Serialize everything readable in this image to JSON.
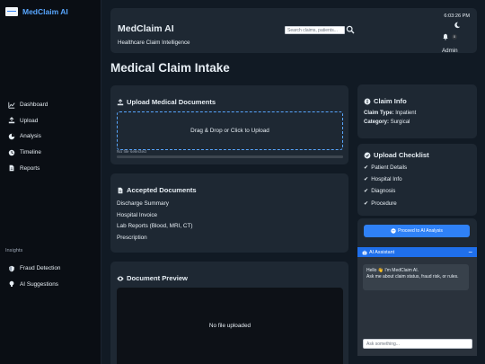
{
  "sidebar": {
    "brand": "MedClaim AI",
    "nav": [
      {
        "label": "Dashboard",
        "icon": "chart-line-icon"
      },
      {
        "label": "Upload",
        "icon": "upload-icon"
      },
      {
        "label": "Analysis",
        "icon": "analysis-icon"
      },
      {
        "label": "Timeline",
        "icon": "clock-icon"
      },
      {
        "label": "Reports",
        "icon": "file-icon"
      }
    ],
    "insights_label": "Insights",
    "insights": [
      {
        "label": "Fraud Detection",
        "icon": "shield-icon"
      },
      {
        "label": "AI Suggestions",
        "icon": "lightbulb-icon"
      }
    ]
  },
  "header": {
    "title": "MedClaim AI",
    "subtitle": "Healthcare Claim Intelligence",
    "search_placeholder": "Search claims, patients...",
    "time": "6:03:26 PM",
    "notification_count": "0",
    "user": "Admin"
  },
  "page_title": "Medical Claim Intake",
  "upload": {
    "title": "Upload Medical Documents",
    "dropzone_text": "Drag & Drop or Click to Upload",
    "file_status": "No file selected",
    "progress": 0
  },
  "accepted": {
    "title": "Accepted Documents",
    "items": [
      "Discharge Summary",
      "Hospital Invoice",
      "Lab Reports (Blood, MRI, CT)",
      "Prescription"
    ]
  },
  "preview": {
    "title": "Document Preview",
    "empty_text": "No file uploaded"
  },
  "claim_info": {
    "title": "Claim Info",
    "type_label": "Claim Type:",
    "type_value": "Inpatient",
    "category_label": "Category:",
    "category_value": "Surgical"
  },
  "checklist": {
    "title": "Upload Checklist",
    "items": [
      "Patient Details",
      "Hospital Info",
      "Diagnosis",
      "Procedure"
    ]
  },
  "assistant": {
    "proceed_label": "Proceed to AI Analysis",
    "title": "AI Assistant",
    "minimize_label": "−",
    "greeting": "Hello 👋 I'm MedClaim AI.",
    "greeting_detail": "Ask me about claim status, fraud risk, or rules.",
    "input_placeholder": "Ask something..."
  },
  "colors": {
    "accent": "#2f81f7",
    "brand_text": "#58a6ff",
    "card_bg": "#1e2833",
    "page_bg": "#111a24"
  }
}
